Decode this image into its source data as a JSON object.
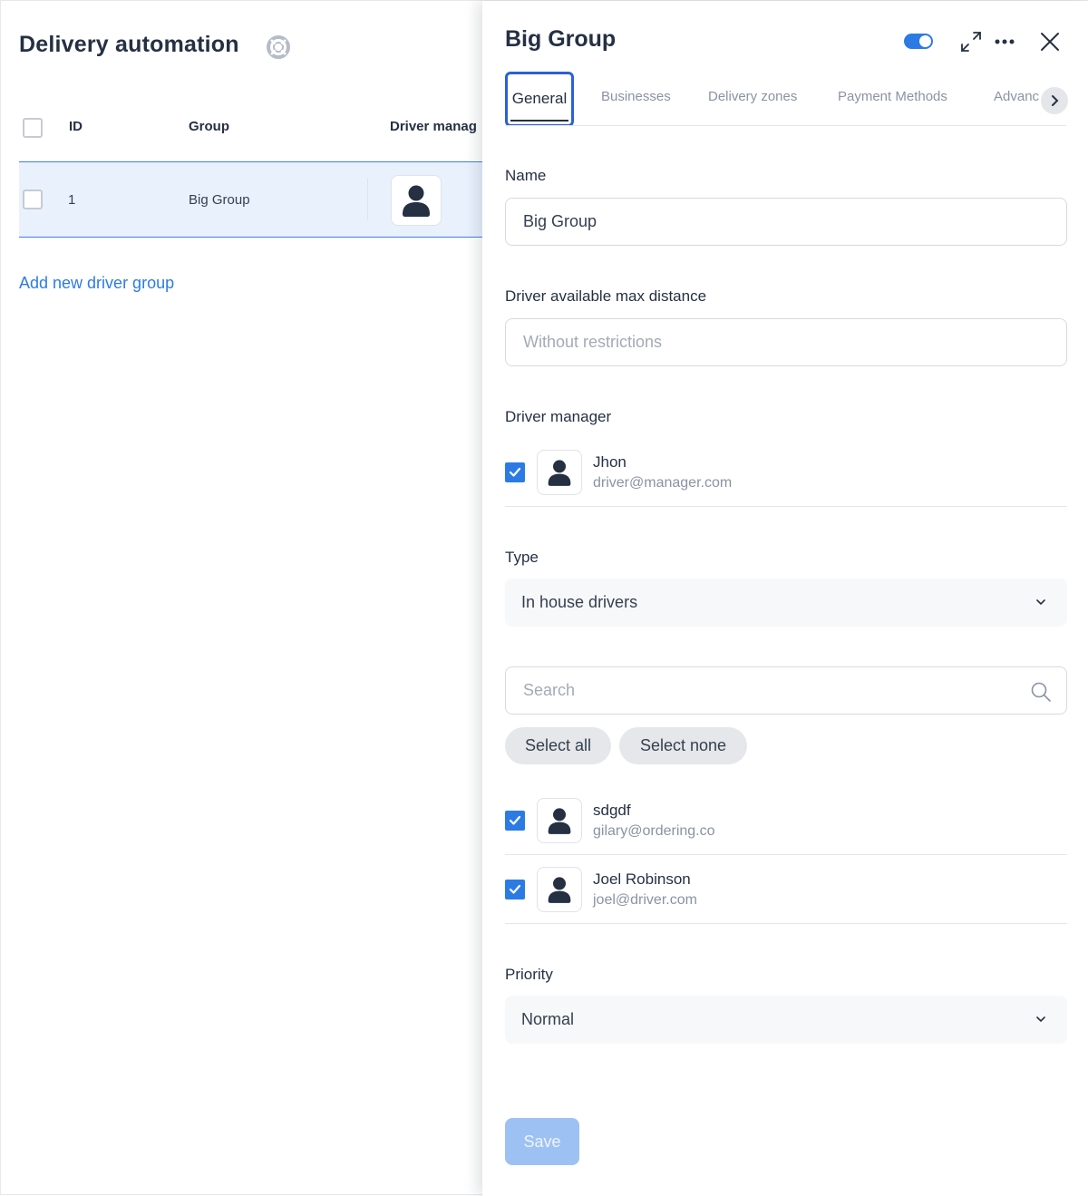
{
  "page": {
    "title": "Delivery automation"
  },
  "table": {
    "columns": [
      "ID",
      "Group",
      "Driver manag"
    ],
    "rows": [
      {
        "id": "1",
        "group": "Big Group"
      }
    ]
  },
  "add_link": "Add new driver group",
  "drawer": {
    "title": "Big Group",
    "enabled": true,
    "tabs": [
      "General",
      "Businesses",
      "Delivery zones",
      "Payment Methods",
      "Advanc"
    ],
    "active_tab": "General",
    "name_label": "Name",
    "name_value": "Big Group",
    "distance_label": "Driver available max distance",
    "distance_placeholder": "Without restrictions",
    "manager_label": "Driver manager",
    "manager": {
      "name": "Jhon",
      "email": "driver@manager.com",
      "checked": true
    },
    "type_label": "Type",
    "type_value": "In house drivers",
    "search_placeholder": "Search",
    "select_all": "Select all",
    "select_none": "Select none",
    "drivers": [
      {
        "name": "sdgdf",
        "email": "gilary@ordering.co",
        "checked": true
      },
      {
        "name": "Joel Robinson",
        "email": "joel@driver.com",
        "checked": true
      }
    ],
    "priority_label": "Priority",
    "priority_value": "Normal",
    "save_label": "Save"
  },
  "colors": {
    "accent": "#2c7be5",
    "selected_row": "#e9f1fd",
    "save_disabled": "#9ec1f3"
  },
  "icons": [
    "help-icon",
    "avatar-icon",
    "toggle-switch",
    "expand-icon",
    "more-icon",
    "close-icon",
    "chevron-right-icon",
    "chevron-down-icon",
    "search-icon",
    "check-icon"
  ]
}
